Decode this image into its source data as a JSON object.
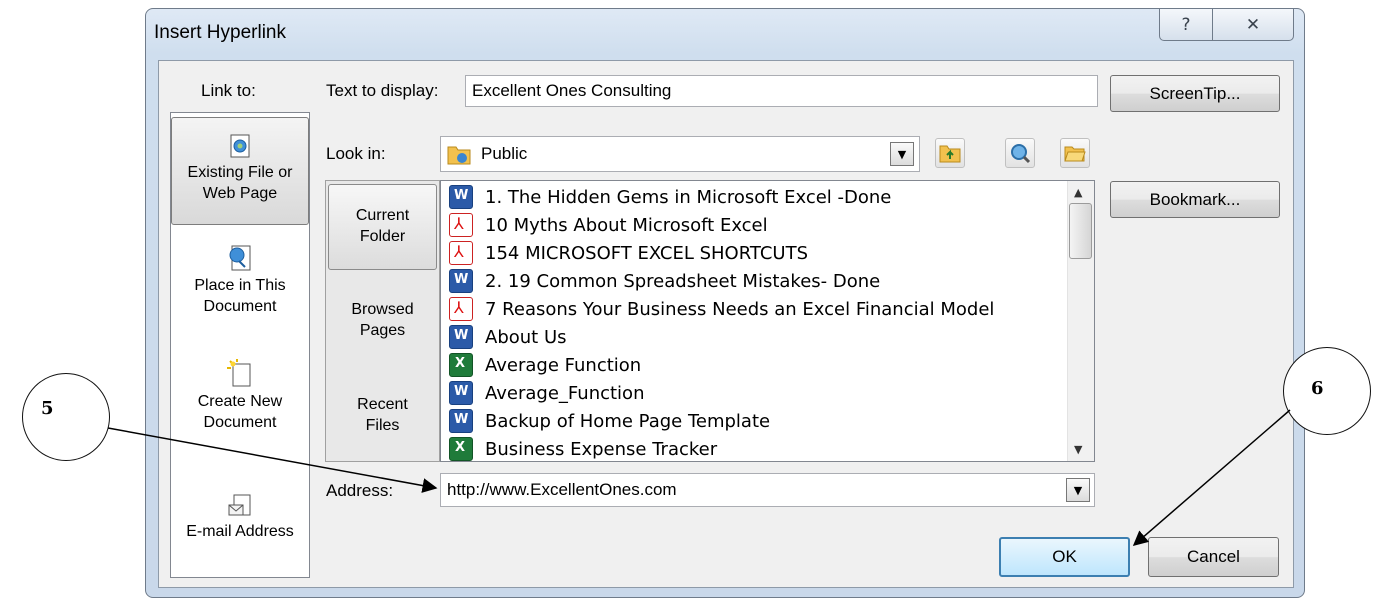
{
  "window": {
    "title": "Insert Hyperlink",
    "help_glyph": "?",
    "close_glyph": "✕"
  },
  "link_to": {
    "heading": "Link to:",
    "items": [
      {
        "label": "Existing File or Web Page",
        "icon": "web-page-icon",
        "selected": true
      },
      {
        "label": "Place in This Document",
        "icon": "document-place-icon",
        "selected": false
      },
      {
        "label": "Create New Document",
        "icon": "new-document-icon",
        "selected": false
      },
      {
        "label": "E-mail Address",
        "icon": "email-icon",
        "selected": false
      }
    ]
  },
  "text_to_display": {
    "label": "Text to display:",
    "value": "Excellent Ones Consulting"
  },
  "screentip_button": "ScreenTip...",
  "look_in": {
    "label": "Look in:",
    "value": "Public"
  },
  "browse_tabs": [
    "Current Folder",
    "Browsed Pages",
    "Recent Files"
  ],
  "files": [
    {
      "name": "1. The Hidden Gems in Microsoft Excel -Done",
      "type": "word"
    },
    {
      "name": "10 Myths About Microsoft Excel",
      "type": "pdf"
    },
    {
      "name": "154 MICROSOFT EXCEL SHORTCUTS",
      "type": "pdf"
    },
    {
      "name": "2. 19 Common Spreadsheet Mistakes- Done",
      "type": "word"
    },
    {
      "name": "7 Reasons Your Business Needs an Excel Financial Model",
      "type": "pdf"
    },
    {
      "name": "About Us",
      "type": "word"
    },
    {
      "name": "Average Function",
      "type": "excel"
    },
    {
      "name": "Average_Function",
      "type": "word"
    },
    {
      "name": "Backup of Home Page Template",
      "type": "word"
    },
    {
      "name": "Business Expense Tracker",
      "type": "excel"
    }
  ],
  "bookmark_button": "Bookmark...",
  "address": {
    "label": "Address:",
    "value": "http://www.ExcellentOnes.com"
  },
  "ok_button": "OK",
  "cancel_button": "Cancel",
  "callouts": [
    "5",
    "6"
  ]
}
